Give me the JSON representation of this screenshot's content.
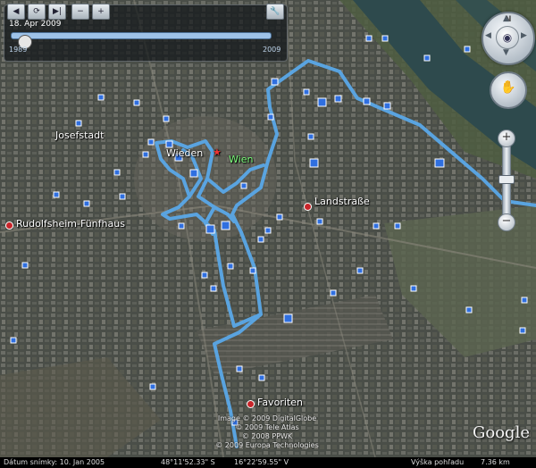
{
  "time_slider": {
    "date": "18. Apr 2009",
    "year_start": "1989",
    "year_end": "2009",
    "position": 0.05
  },
  "places": {
    "josefstadt": "Josefstadt",
    "rudolfsheim": "Rudolfsheim-Fünfhaus",
    "landstrasse": "Landstraße",
    "favoriten": "Favoriten",
    "wieden": "Wieden",
    "wien": "Wien"
  },
  "nav": {
    "north": "N"
  },
  "copyright": [
    "Image © 2009 DigitalGlobe",
    "© 2009 Tele Atlas",
    "© 2008 PPWK",
    "© 2009 Europa Technologies"
  ],
  "logo": "Google",
  "status": {
    "image_date": "Dátum snímky: 10. Jan 2005",
    "lat": "48°11'52.33\" S",
    "lon": "16°22'59.55\" V",
    "elev_label": "Výška pohľadu",
    "elev_value": "7.36 km"
  },
  "colors": {
    "track": "#5aa8e8",
    "marker": "#2f6fe0"
  },
  "icons": {
    "play": "play-icon",
    "refresh": "refresh-icon",
    "step": "step-icon",
    "zoom_out": "zoom-out-icon",
    "zoom_in": "zoom-in-icon",
    "settings": "wrench-icon"
  }
}
